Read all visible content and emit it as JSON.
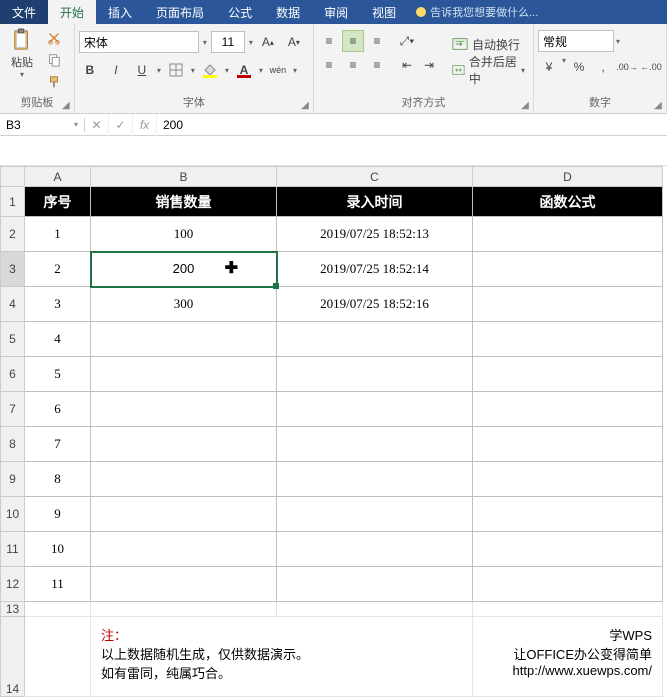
{
  "menu": {
    "file": "文件",
    "home": "开始",
    "insert": "插入",
    "layout": "页面布局",
    "formula": "公式",
    "data": "数据",
    "review": "审阅",
    "view": "视图",
    "tellme": "告诉我您想要做什么..."
  },
  "ribbon": {
    "clipboard": {
      "paste": "粘贴",
      "label": "剪贴板"
    },
    "font": {
      "name": "宋体",
      "size": "11",
      "label": "字体",
      "wen": "wén",
      "bold": "B",
      "italic": "I",
      "underline": "U"
    },
    "align": {
      "wrap": "自动换行",
      "merge": "合并后居中",
      "label": "对齐方式"
    },
    "number": {
      "format": "常规",
      "label": "数字",
      "currency": "¥",
      "percent": "%",
      "comma": ","
    }
  },
  "fbar": {
    "name": "B3",
    "fx": "fx",
    "formula": "200"
  },
  "headers": {
    "A": "A",
    "B": "B",
    "C": "C",
    "D": "D"
  },
  "table": {
    "h1": "序号",
    "h2": "销售数量",
    "h3": "录入时间",
    "h4": "函数公式",
    "rows": [
      {
        "n": "1",
        "qty": "100",
        "time": "2019/07/25 18:52:13"
      },
      {
        "n": "2",
        "qty": "200",
        "time": "2019/07/25 18:52:14"
      },
      {
        "n": "3",
        "qty": "300",
        "time": "2019/07/25 18:52:16"
      },
      {
        "n": "4",
        "qty": "",
        "time": ""
      },
      {
        "n": "5",
        "qty": "",
        "time": ""
      },
      {
        "n": "6",
        "qty": "",
        "time": ""
      },
      {
        "n": "7",
        "qty": "",
        "time": ""
      },
      {
        "n": "8",
        "qty": "",
        "time": ""
      },
      {
        "n": "9",
        "qty": "",
        "time": ""
      },
      {
        "n": "10",
        "qty": "",
        "time": ""
      },
      {
        "n": "11",
        "qty": "",
        "time": ""
      }
    ]
  },
  "note": {
    "title": "注：",
    "line1": "以上数据随机生成，仅供数据演示。",
    "line2": "如有雷同，纯属巧合。",
    "r1": "学WPS",
    "r2": "让OFFICE办公变得简单",
    "r3": "http://www.xuewps.com/"
  }
}
